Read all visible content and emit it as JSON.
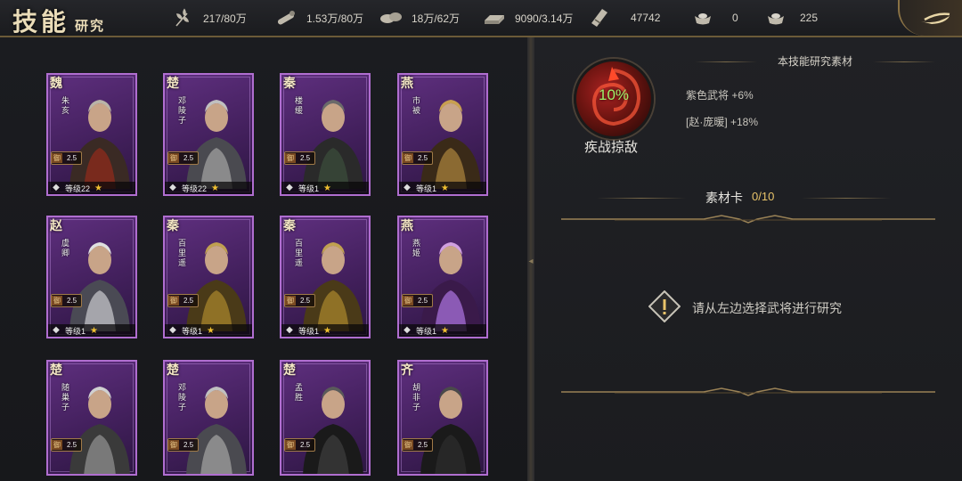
{
  "header": {
    "title_main": "技能",
    "title_sub": "研究",
    "resources": [
      {
        "icon": "grain-icon",
        "value": "217/80万"
      },
      {
        "icon": "wood-icon",
        "value": "1.53万/80万"
      },
      {
        "icon": "stone-icon",
        "value": "18万/62万"
      },
      {
        "icon": "iron-icon",
        "value": "9090/3.14万"
      },
      {
        "icon": "order-icon",
        "value": "47742"
      },
      {
        "icon": "gold-icon",
        "value": "0"
      },
      {
        "icon": "silver-icon",
        "value": "225"
      }
    ]
  },
  "heroes": [
    {
      "kingdom": "魏",
      "name": "朱亥",
      "cost_key": "御",
      "cost": "2.5",
      "level": "等级22",
      "class_icon": "spear-class-icon"
    },
    {
      "kingdom": "楚",
      "name": "邓陵子",
      "cost_key": "御",
      "cost": "2.5",
      "level": "等级22",
      "class_icon": "spear-class-icon"
    },
    {
      "kingdom": "秦",
      "name": "楼缓",
      "cost_key": "御",
      "cost": "2.5",
      "level": "等级1",
      "class_icon": "sword-class-icon"
    },
    {
      "kingdom": "燕",
      "name": "市被",
      "cost_key": "御",
      "cost": "2.5",
      "level": "等级1",
      "class_icon": "cavalry-class-icon"
    },
    {
      "kingdom": "赵",
      "name": "虞卿",
      "cost_key": "御",
      "cost": "2.5",
      "level": "等级1",
      "class_icon": "cavalry-class-icon"
    },
    {
      "kingdom": "秦",
      "name": "百里遥",
      "cost_key": "御",
      "cost": "2.5",
      "level": "等级1",
      "class_icon": "cavalry-class-icon"
    },
    {
      "kingdom": "秦",
      "name": "百里遥",
      "cost_key": "御",
      "cost": "2.5",
      "level": "等级1",
      "class_icon": "cavalry-class-icon"
    },
    {
      "kingdom": "燕",
      "name": "燕姬",
      "cost_key": "御",
      "cost": "2.5",
      "level": "等级1",
      "class_icon": "cavalry-class-icon"
    },
    {
      "kingdom": "楚",
      "name": "随巢子",
      "cost_key": "御",
      "cost": "2.5",
      "level": "",
      "class_icon": ""
    },
    {
      "kingdom": "楚",
      "name": "邓陵子",
      "cost_key": "御",
      "cost": "2.5",
      "level": "",
      "class_icon": ""
    },
    {
      "kingdom": "楚",
      "name": "孟胜",
      "cost_key": "御",
      "cost": "2.5",
      "level": "",
      "class_icon": ""
    },
    {
      "kingdom": "齐",
      "name": "胡非子",
      "cost_key": "御",
      "cost": "2.5",
      "level": "",
      "class_icon": ""
    }
  ],
  "skill": {
    "progress": "10%",
    "name": "疾战掠敌"
  },
  "materials": {
    "title": "本技能研究素材",
    "bonuses": [
      "紫色武将 +6%",
      "[赵·庞暖] +18%"
    ],
    "card_label": "素材卡",
    "card_count": "0/10"
  },
  "hint": "请从左边选择武将进行研究",
  "colors": {
    "accent_gold": "#b89a5e",
    "card_purple": "#5e2f7e",
    "progress_green": "#9ff06a",
    "count_gold": "#e9c46a"
  }
}
